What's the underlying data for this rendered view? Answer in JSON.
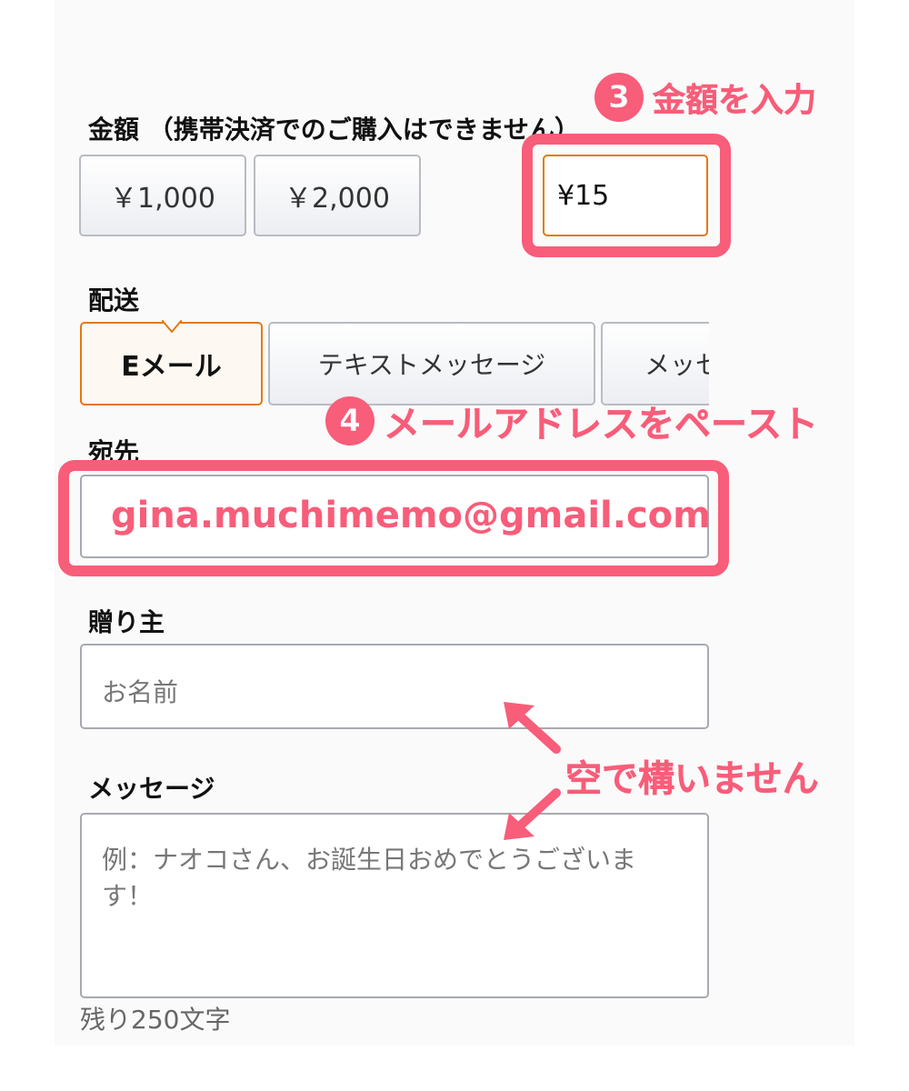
{
  "amount": {
    "label": "金額 （携帯決済でのご購入はできません）",
    "options": [
      "￥1,000",
      "￥2,000"
    ],
    "custom_value": "¥15"
  },
  "delivery": {
    "label": "配送",
    "tabs": [
      "Eメール",
      "テキストメッセージ",
      "メッセ"
    ],
    "selected": "Eメール"
  },
  "recipient": {
    "label": "宛先",
    "value": "gina.muchimemo@gmail.com"
  },
  "sender": {
    "label": "贈り主",
    "placeholder": "お名前"
  },
  "message": {
    "label": "メッセージ",
    "placeholder": "例：ナオコさん、お誕生日おめでとうございます！",
    "counter": "残り250文字"
  },
  "annotations": {
    "step3_number": "3",
    "step3_text": "金額を入力",
    "step4_number": "4",
    "step4_text": "メールアドレスをペースト",
    "empty_ok": "空で構いません"
  },
  "colors": {
    "accent_pink": "#f85d79",
    "selected_orange": "#e47911"
  }
}
